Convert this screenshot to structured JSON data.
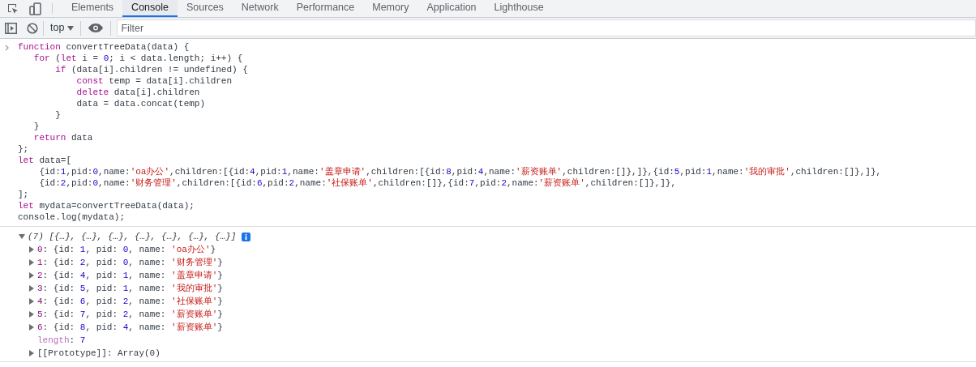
{
  "tabs": [
    {
      "label": "Elements",
      "selected": false
    },
    {
      "label": "Console",
      "selected": true
    },
    {
      "label": "Sources",
      "selected": false
    },
    {
      "label": "Network",
      "selected": false
    },
    {
      "label": "Performance",
      "selected": false
    },
    {
      "label": "Memory",
      "selected": false
    },
    {
      "label": "Application",
      "selected": false
    },
    {
      "label": "Lighthouse",
      "selected": false
    }
  ],
  "toolbar": {
    "context": "top",
    "filter": {
      "placeholder": "Filter"
    }
  },
  "input_lines": [
    [
      {
        "kind": "keyword",
        "text": "function"
      },
      {
        "kind": "plain",
        "text": " convertTreeData(data) {"
      }
    ],
    [
      {
        "kind": "keyword",
        "text": "   for"
      },
      {
        "kind": "plain",
        "text": " ("
      },
      {
        "kind": "keyword",
        "text": "let"
      },
      {
        "kind": "plain",
        "text": " i = "
      },
      {
        "kind": "number",
        "text": "0"
      },
      {
        "kind": "plain",
        "text": "; i < data.length; i++) {"
      }
    ],
    [
      {
        "kind": "keyword",
        "text": "       if"
      },
      {
        "kind": "plain",
        "text": " (data[i].children != undefined) {"
      }
    ],
    [
      {
        "kind": "keyword",
        "text": "           const"
      },
      {
        "kind": "plain",
        "text": " temp = data[i].children"
      }
    ],
    [
      {
        "kind": "keyword",
        "text": "           delete"
      },
      {
        "kind": "plain",
        "text": " data[i].children"
      }
    ],
    [
      {
        "kind": "plain",
        "text": "           data = data.concat(temp)"
      }
    ],
    [
      {
        "kind": "plain",
        "text": "       }"
      }
    ],
    [
      {
        "kind": "plain",
        "text": "   }"
      }
    ],
    [
      {
        "kind": "keyword",
        "text": "   return"
      },
      {
        "kind": "plain",
        "text": " data"
      }
    ],
    [
      {
        "kind": "plain",
        "text": "};"
      }
    ],
    [
      {
        "kind": "keyword",
        "text": "let"
      },
      {
        "kind": "plain",
        "text": " data=["
      }
    ],
    [
      {
        "kind": "plain",
        "text": "    {id:"
      },
      {
        "kind": "number",
        "text": "1"
      },
      {
        "kind": "plain",
        "text": ",pid:"
      },
      {
        "kind": "number",
        "text": "0"
      },
      {
        "kind": "plain",
        "text": ",name:"
      },
      {
        "kind": "string",
        "text": "'oa办公'"
      },
      {
        "kind": "plain",
        "text": ",children:[{id:"
      },
      {
        "kind": "number",
        "text": "4"
      },
      {
        "kind": "plain",
        "text": ",pid:"
      },
      {
        "kind": "number",
        "text": "1"
      },
      {
        "kind": "plain",
        "text": ",name:"
      },
      {
        "kind": "string",
        "text": "'盖章申请'"
      },
      {
        "kind": "plain",
        "text": ",children:[{id:"
      },
      {
        "kind": "number",
        "text": "8"
      },
      {
        "kind": "plain",
        "text": ",pid:"
      },
      {
        "kind": "number",
        "text": "4"
      },
      {
        "kind": "plain",
        "text": ",name:"
      },
      {
        "kind": "string",
        "text": "'薪资账单'"
      },
      {
        "kind": "plain",
        "text": ",children:[]},]},{id:"
      },
      {
        "kind": "number",
        "text": "5"
      },
      {
        "kind": "plain",
        "text": ",pid:"
      },
      {
        "kind": "number",
        "text": "1"
      },
      {
        "kind": "plain",
        "text": ",name:"
      },
      {
        "kind": "string",
        "text": "'我的审批'"
      },
      {
        "kind": "plain",
        "text": ",children:[]},]},"
      }
    ],
    [
      {
        "kind": "plain",
        "text": "    {id:"
      },
      {
        "kind": "number",
        "text": "2"
      },
      {
        "kind": "plain",
        "text": ",pid:"
      },
      {
        "kind": "number",
        "text": "0"
      },
      {
        "kind": "plain",
        "text": ",name:"
      },
      {
        "kind": "string",
        "text": "'财务管理'"
      },
      {
        "kind": "plain",
        "text": ",children:[{id:"
      },
      {
        "kind": "number",
        "text": "6"
      },
      {
        "kind": "plain",
        "text": ",pid:"
      },
      {
        "kind": "number",
        "text": "2"
      },
      {
        "kind": "plain",
        "text": ",name:"
      },
      {
        "kind": "string",
        "text": "'社保账单'"
      },
      {
        "kind": "plain",
        "text": ",children:[]},{id:"
      },
      {
        "kind": "number",
        "text": "7"
      },
      {
        "kind": "plain",
        "text": ",pid:"
      },
      {
        "kind": "number",
        "text": "2"
      },
      {
        "kind": "plain",
        "text": ",name:"
      },
      {
        "kind": "string",
        "text": "'薪资账单'"
      },
      {
        "kind": "plain",
        "text": ",children:[]},]},"
      }
    ],
    [
      {
        "kind": "plain",
        "text": "];"
      }
    ],
    [
      {
        "kind": "keyword",
        "text": "let"
      },
      {
        "kind": "plain",
        "text": " mydata=convertTreeData(data);"
      }
    ],
    [
      {
        "kind": "plain",
        "text": "console.log(mydata);"
      }
    ]
  ],
  "output": {
    "summary": {
      "expanded": true,
      "text": "(7) [{…}, {…}, {…}, {…}, {…}, {…}, {…}]"
    },
    "rows": [
      {
        "expanded": false,
        "tokens": [
          {
            "kind": "key",
            "text": "0"
          },
          {
            "kind": "plain",
            "text": ": {id: "
          },
          {
            "kind": "number",
            "text": "1"
          },
          {
            "kind": "plain",
            "text": ", pid: "
          },
          {
            "kind": "number",
            "text": "0"
          },
          {
            "kind": "plain",
            "text": ", name: "
          },
          {
            "kind": "string",
            "text": "'oa办公'"
          },
          {
            "kind": "plain",
            "text": "}"
          }
        ]
      },
      {
        "expanded": false,
        "tokens": [
          {
            "kind": "key",
            "text": "1"
          },
          {
            "kind": "plain",
            "text": ": {id: "
          },
          {
            "kind": "number",
            "text": "2"
          },
          {
            "kind": "plain",
            "text": ", pid: "
          },
          {
            "kind": "number",
            "text": "0"
          },
          {
            "kind": "plain",
            "text": ", name: "
          },
          {
            "kind": "string",
            "text": "'财务管理'"
          },
          {
            "kind": "plain",
            "text": "}"
          }
        ]
      },
      {
        "expanded": false,
        "tokens": [
          {
            "kind": "key",
            "text": "2"
          },
          {
            "kind": "plain",
            "text": ": {id: "
          },
          {
            "kind": "number",
            "text": "4"
          },
          {
            "kind": "plain",
            "text": ", pid: "
          },
          {
            "kind": "number",
            "text": "1"
          },
          {
            "kind": "plain",
            "text": ", name: "
          },
          {
            "kind": "string",
            "text": "'盖章申请'"
          },
          {
            "kind": "plain",
            "text": "}"
          }
        ]
      },
      {
        "expanded": false,
        "tokens": [
          {
            "kind": "key",
            "text": "3"
          },
          {
            "kind": "plain",
            "text": ": {id: "
          },
          {
            "kind": "number",
            "text": "5"
          },
          {
            "kind": "plain",
            "text": ", pid: "
          },
          {
            "kind": "number",
            "text": "1"
          },
          {
            "kind": "plain",
            "text": ", name: "
          },
          {
            "kind": "string",
            "text": "'我的审批'"
          },
          {
            "kind": "plain",
            "text": "}"
          }
        ]
      },
      {
        "expanded": false,
        "tokens": [
          {
            "kind": "key",
            "text": "4"
          },
          {
            "kind": "plain",
            "text": ": {id: "
          },
          {
            "kind": "number",
            "text": "6"
          },
          {
            "kind": "plain",
            "text": ", pid: "
          },
          {
            "kind": "number",
            "text": "2"
          },
          {
            "kind": "plain",
            "text": ", name: "
          },
          {
            "kind": "string",
            "text": "'社保账单'"
          },
          {
            "kind": "plain",
            "text": "}"
          }
        ]
      },
      {
        "expanded": false,
        "tokens": [
          {
            "kind": "key",
            "text": "5"
          },
          {
            "kind": "plain",
            "text": ": {id: "
          },
          {
            "kind": "number",
            "text": "7"
          },
          {
            "kind": "plain",
            "text": ", pid: "
          },
          {
            "kind": "number",
            "text": "2"
          },
          {
            "kind": "plain",
            "text": ", name: "
          },
          {
            "kind": "string",
            "text": "'薪资账单'"
          },
          {
            "kind": "plain",
            "text": "}"
          }
        ]
      },
      {
        "expanded": false,
        "tokens": [
          {
            "kind": "key",
            "text": "6"
          },
          {
            "kind": "plain",
            "text": ": {id: "
          },
          {
            "kind": "number",
            "text": "8"
          },
          {
            "kind": "plain",
            "text": ", pid: "
          },
          {
            "kind": "number",
            "text": "4"
          },
          {
            "kind": "plain",
            "text": ", name: "
          },
          {
            "kind": "string",
            "text": "'薪资账单'"
          },
          {
            "kind": "plain",
            "text": "}"
          }
        ]
      },
      {
        "tokens": [
          {
            "kind": "dimkey",
            "text": "length"
          },
          {
            "kind": "plain",
            "text": ": "
          },
          {
            "kind": "number",
            "text": "7"
          }
        ]
      },
      {
        "expanded": false,
        "tokens": [
          {
            "kind": "plain",
            "text": "[[Prototype]]: Array(0)"
          }
        ]
      }
    ]
  }
}
